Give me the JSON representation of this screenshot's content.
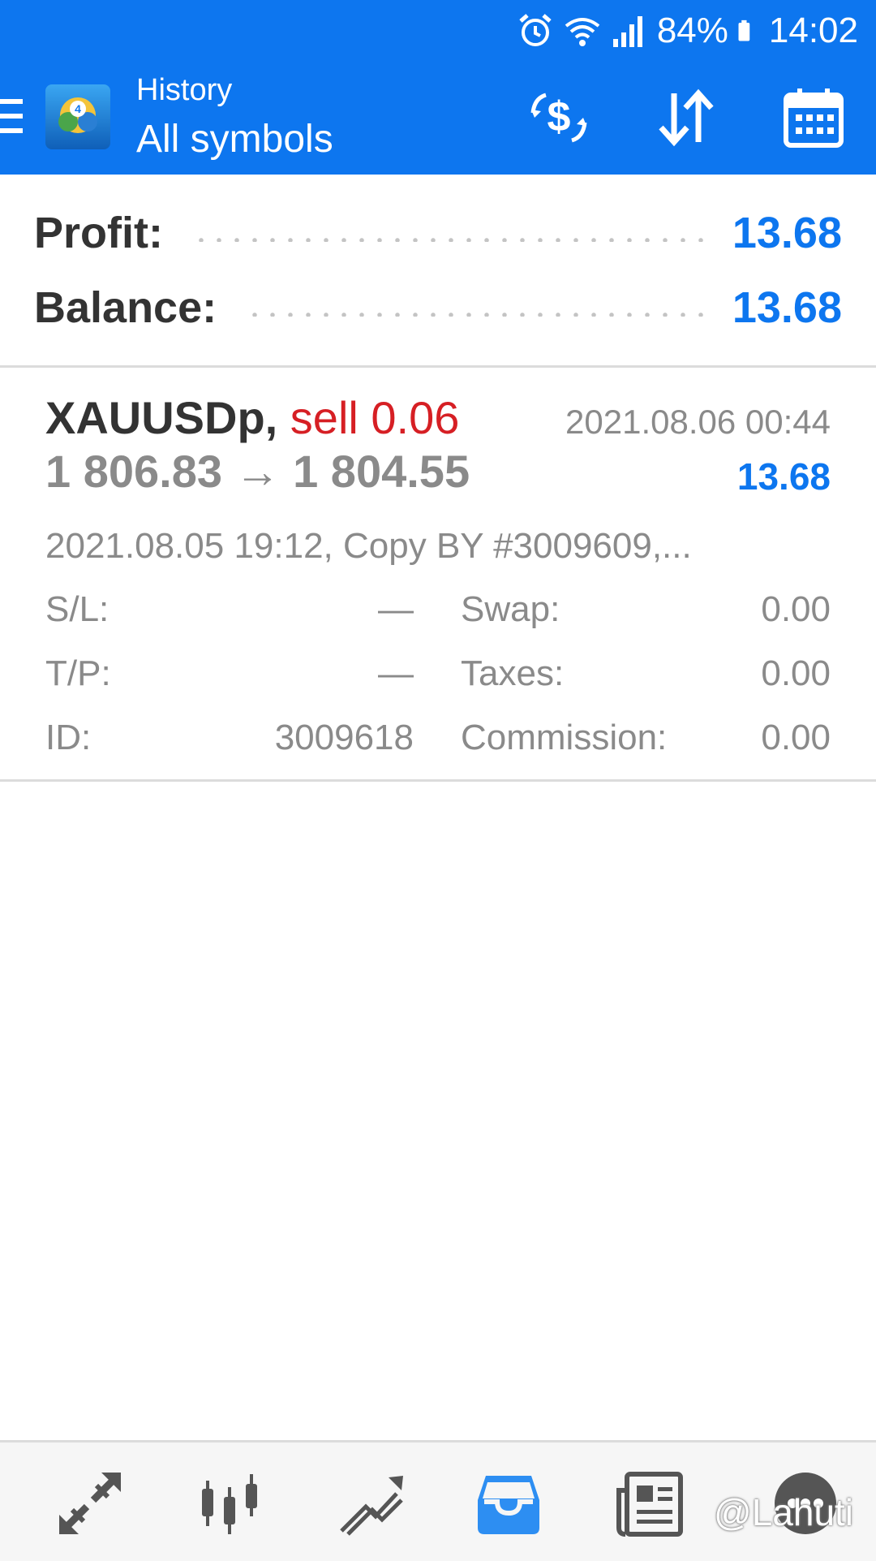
{
  "status_bar": {
    "battery": "84%",
    "time": "14:02",
    "icons": [
      "alarm-icon",
      "wifi-icon",
      "signal-icon",
      "battery-icon"
    ]
  },
  "header": {
    "subtitle": "History",
    "title": "All symbols",
    "actions": [
      "balance-operations-icon",
      "sort-icon",
      "calendar-icon"
    ]
  },
  "summary": {
    "profit_label": "Profit:",
    "profit_value": "13.68",
    "balance_label": "Balance:",
    "balance_value": "13.68"
  },
  "trade": {
    "symbol": "XAUUSDp,",
    "direction": "sell 0.06",
    "close_time": "2021.08.06 00:44",
    "prices": "1 806.83 → 1 804.55",
    "profit": "13.68",
    "comment": "2021.08.05 19:12, Copy BY #3009609,...",
    "sl_label": "S/L:",
    "sl_value": "—",
    "tp_label": "T/P:",
    "tp_value": "—",
    "id_label": "ID:",
    "id_value": "3009618",
    "swap_label": "Swap:",
    "swap_value": "0.00",
    "taxes_label": "Taxes:",
    "taxes_value": "0.00",
    "commission_label": "Commission:",
    "commission_value": "0.00"
  },
  "bottom_nav": {
    "items": [
      "quotes-icon",
      "chart-icon",
      "trade-icon",
      "history-icon",
      "news-icon",
      "messages-icon"
    ],
    "active": "history-icon"
  },
  "watermark": "@Lahuti",
  "colors": {
    "primary": "#0d76ef",
    "sell": "#d61f24",
    "text_dark": "#333333",
    "text_muted": "#8a8a8a"
  }
}
